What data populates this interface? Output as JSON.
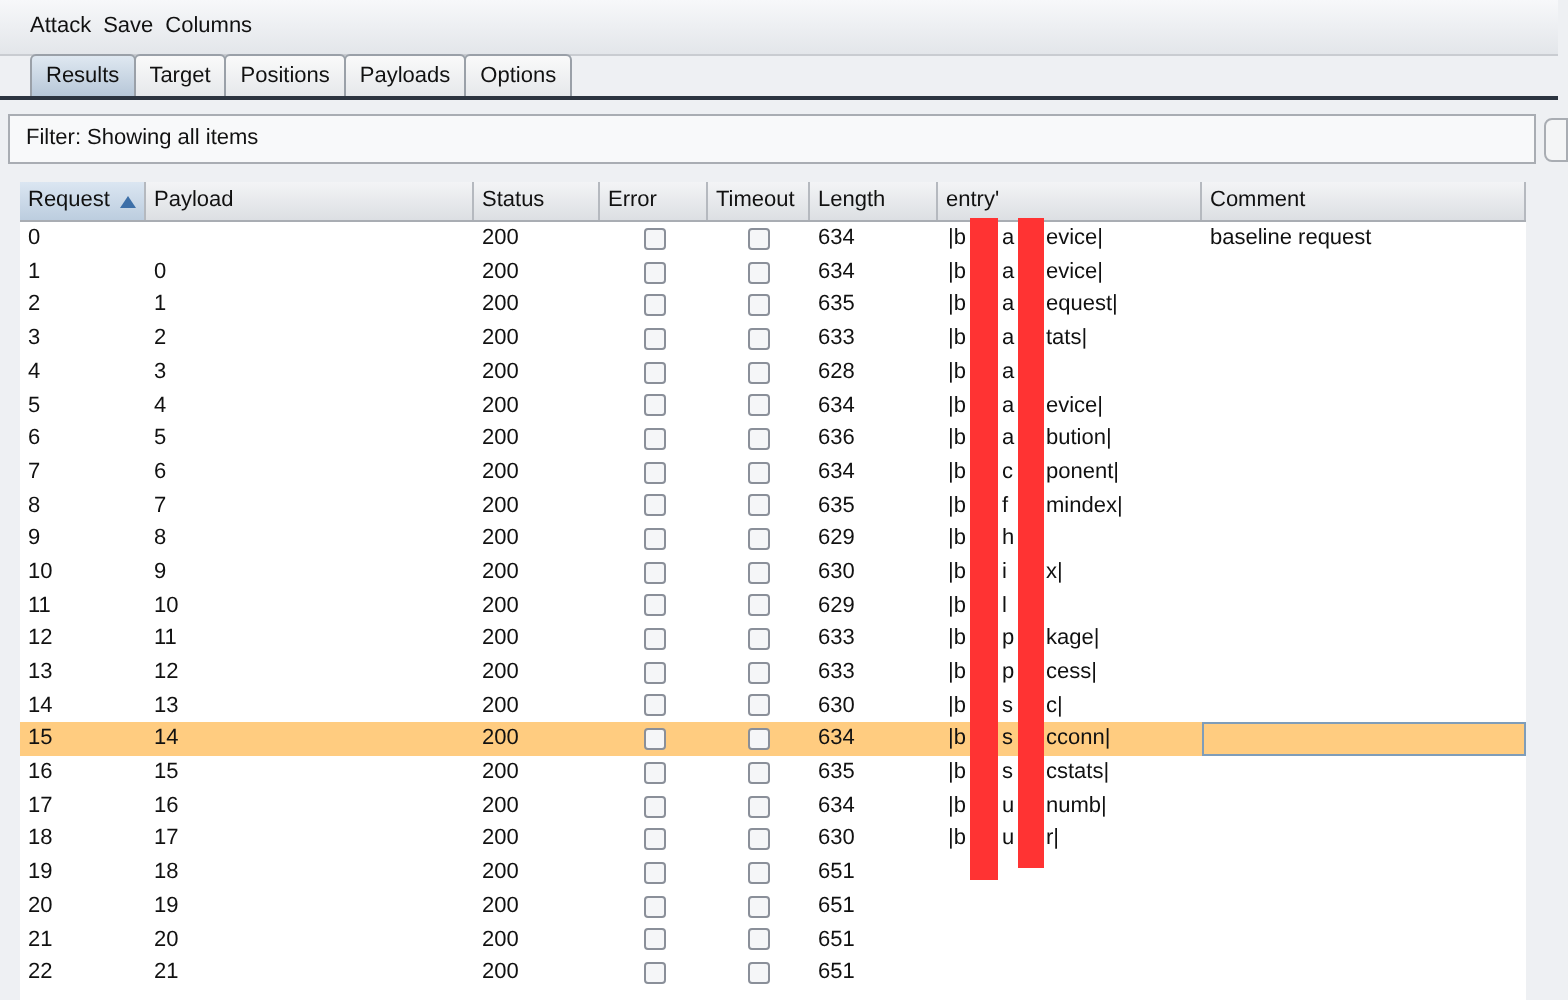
{
  "menu": [
    "Attack",
    "Save",
    "Columns"
  ],
  "tabs": [
    {
      "label": "Results",
      "selected": true
    },
    {
      "label": "Target",
      "selected": false
    },
    {
      "label": "Positions",
      "selected": false
    },
    {
      "label": "Payloads",
      "selected": false
    },
    {
      "label": "Options",
      "selected": false
    }
  ],
  "filter": "Filter:  Showing all items",
  "table": {
    "columns": [
      {
        "label": "Request",
        "sorted": true
      },
      {
        "label": "Payload",
        "sorted": false
      },
      {
        "label": "Status",
        "sorted": false
      },
      {
        "label": "Error",
        "sorted": false
      },
      {
        "label": "Timeout",
        "sorted": false
      },
      {
        "label": "Length",
        "sorted": false
      },
      {
        "label": "entry'",
        "sorted": false
      },
      {
        "label": "Comment",
        "sorted": false
      }
    ],
    "rows": [
      {
        "request": "0",
        "status": "200",
        "error": false,
        "timeout": false,
        "length": "634",
        "entry": [
          "|b",
          "a",
          "evice|"
        ],
        "comment": "baseline request",
        "selected": false
      },
      {
        "request": "1",
        "payload": "0",
        "status": "200",
        "error": false,
        "timeout": false,
        "length": "634",
        "entry": [
          "|b",
          "a",
          "evice|"
        ],
        "selected": false
      },
      {
        "request": "2",
        "payload": "1",
        "status": "200",
        "error": false,
        "timeout": false,
        "length": "635",
        "entry": [
          "|b",
          "a",
          "equest|"
        ],
        "selected": false
      },
      {
        "request": "3",
        "payload": "2",
        "status": "200",
        "error": false,
        "timeout": false,
        "length": "633",
        "entry": [
          "|b",
          "a",
          "tats|"
        ],
        "selected": false
      },
      {
        "request": "4",
        "payload": "3",
        "status": "200",
        "error": false,
        "timeout": false,
        "length": "628",
        "entry": [
          "|b",
          "a"
        ],
        "selected": false
      },
      {
        "request": "5",
        "payload": "4",
        "status": "200",
        "error": false,
        "timeout": false,
        "length": "634",
        "entry": [
          "|b",
          "a",
          "evice|"
        ],
        "selected": false
      },
      {
        "request": "6",
        "payload": "5",
        "status": "200",
        "error": false,
        "timeout": false,
        "length": "636",
        "entry": [
          "|b",
          "a",
          "bution|"
        ],
        "selected": false
      },
      {
        "request": "7",
        "payload": "6",
        "status": "200",
        "error": false,
        "timeout": false,
        "length": "634",
        "entry": [
          "|b",
          "c",
          "ponent|"
        ],
        "selected": false
      },
      {
        "request": "8",
        "payload": "7",
        "status": "200",
        "error": false,
        "timeout": false,
        "length": "635",
        "entry": [
          "|b",
          "f",
          "mindex|"
        ],
        "selected": false
      },
      {
        "request": "9",
        "payload": "8",
        "status": "200",
        "error": false,
        "timeout": false,
        "length": "629",
        "entry": [
          "|b",
          "h"
        ],
        "selected": false
      },
      {
        "request": "10",
        "payload": "9",
        "status": "200",
        "error": false,
        "timeout": false,
        "length": "630",
        "entry": [
          "|b",
          "i",
          "x|"
        ],
        "selected": false
      },
      {
        "request": "11",
        "payload": "10",
        "status": "200",
        "error": false,
        "timeout": false,
        "length": "629",
        "entry": [
          "|b",
          "l"
        ],
        "selected": false
      },
      {
        "request": "12",
        "payload": "11",
        "status": "200",
        "error": false,
        "timeout": false,
        "length": "633",
        "entry": [
          "|b",
          "p",
          "kage|"
        ],
        "selected": false
      },
      {
        "request": "13",
        "payload": "12",
        "status": "200",
        "error": false,
        "timeout": false,
        "length": "633",
        "entry": [
          "|b",
          "p",
          "cess|"
        ],
        "selected": false
      },
      {
        "request": "14",
        "payload": "13",
        "status": "200",
        "error": false,
        "timeout": false,
        "length": "630",
        "entry": [
          "|b",
          "s",
          "c|"
        ],
        "selected": false
      },
      {
        "request": "15",
        "payload": "14",
        "status": "200",
        "error": false,
        "timeout": false,
        "length": "634",
        "entry": [
          "|b",
          "s",
          "cconn|"
        ],
        "selected": true
      },
      {
        "request": "16",
        "payload": "15",
        "status": "200",
        "error": false,
        "timeout": false,
        "length": "635",
        "entry": [
          "|b",
          "s",
          "cstats|"
        ],
        "selected": false
      },
      {
        "request": "17",
        "payload": "16",
        "status": "200",
        "error": false,
        "timeout": false,
        "length": "634",
        "entry": [
          "|b",
          "u",
          "numb|"
        ],
        "selected": false
      },
      {
        "request": "18",
        "payload": "17",
        "status": "200",
        "error": false,
        "timeout": false,
        "length": "630",
        "entry": [
          "|b",
          "u",
          "r|"
        ],
        "selected": false
      },
      {
        "request": "19",
        "payload": "18",
        "status": "200",
        "error": false,
        "timeout": false,
        "length": "651",
        "selected": false
      },
      {
        "request": "20",
        "payload": "19",
        "status": "200",
        "error": false,
        "timeout": false,
        "length": "651",
        "selected": false
      },
      {
        "request": "21",
        "payload": "20",
        "status": "200",
        "error": false,
        "timeout": false,
        "length": "651",
        "selected": false
      },
      {
        "request": "22",
        "payload": "21",
        "status": "200",
        "error": false,
        "timeout": false,
        "length": "651",
        "selected": false
      }
    ]
  }
}
